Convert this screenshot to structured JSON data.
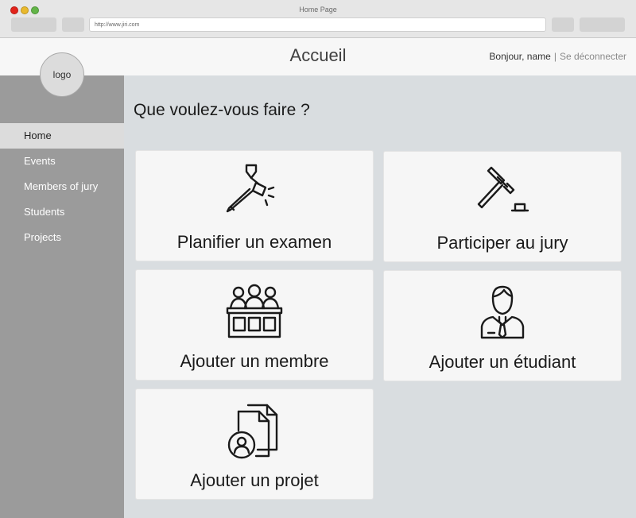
{
  "browser": {
    "tab_title": "Home Page",
    "url": "http://www.jiri.com"
  },
  "header": {
    "title": "Accueil",
    "greeting": "Bonjour, name",
    "separator": "|",
    "logout_label": "Se déconnecter"
  },
  "sidebar": {
    "logo_text": "logo",
    "items": [
      {
        "label": "Home",
        "active": true
      },
      {
        "label": "Events",
        "active": false
      },
      {
        "label": "Members of jury",
        "active": false
      },
      {
        "label": "Students",
        "active": false
      },
      {
        "label": "Projects",
        "active": false
      }
    ]
  },
  "main": {
    "question": "Que voulez-vous faire ?",
    "cards": [
      {
        "label": "Planifier un examen",
        "icon": "gavel-pencil-icon"
      },
      {
        "label": "Participer au jury",
        "icon": "gavel-icon"
      },
      {
        "label": "Ajouter un membre",
        "icon": "jury-panel-icon"
      },
      {
        "label": "Ajouter un étudiant",
        "icon": "student-icon"
      },
      {
        "label": "Ajouter un projet",
        "icon": "project-documents-icon"
      }
    ]
  },
  "colors": {
    "sidebar_bg": "#9b9b9b",
    "main_bg": "#d9dde0",
    "card_bg": "#f6f6f6",
    "active_nav_bg": "#dcdcdc"
  }
}
